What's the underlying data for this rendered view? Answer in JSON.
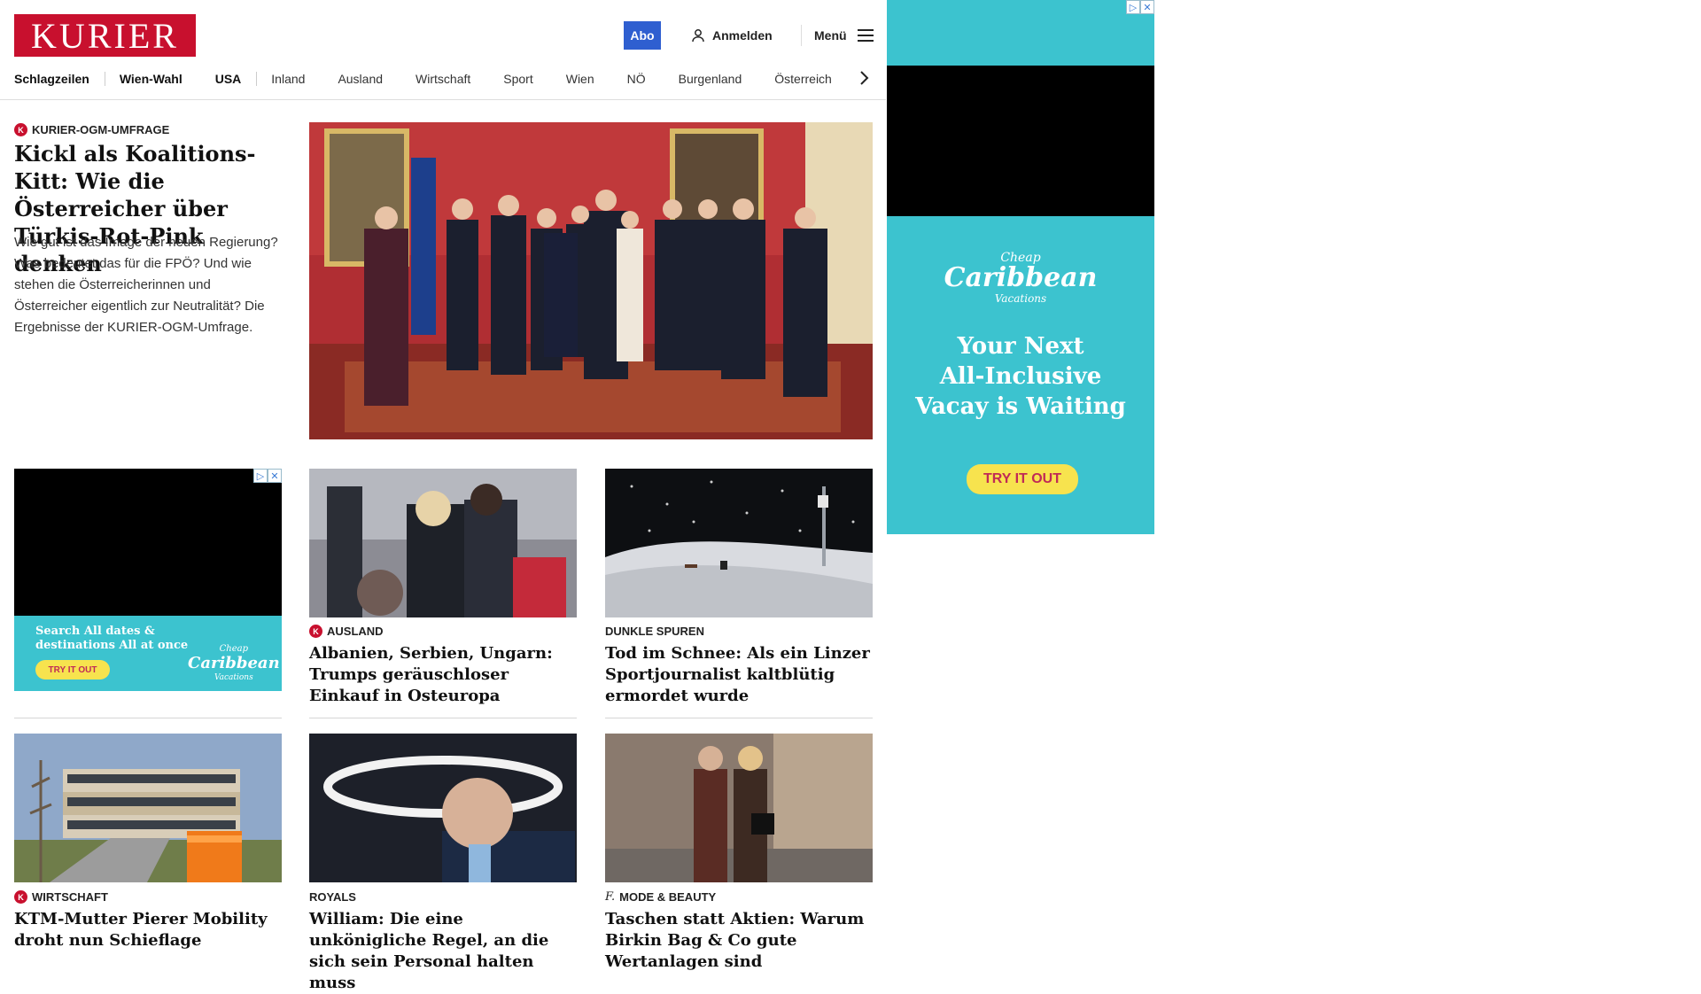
{
  "header": {
    "logo": "KURIER",
    "abo_label": "Abo",
    "login_label": "Anmelden",
    "menu_label": "Menü"
  },
  "nav": [
    "Schlagzeilen",
    "Wien-Wahl",
    "USA",
    "Inland",
    "Ausland",
    "Wirtschaft",
    "Sport",
    "Wien",
    "NÖ",
    "Burgenland",
    "Österreich"
  ],
  "lead": {
    "badge": "K",
    "kicker": "KURIER-OGM-UMFRAGE",
    "title": "Kickl als Koalitions-Kitt: Wie die Österreicher über Türkis-Rot-Pink denken",
    "teaser": "Wie gut ist das Image der neuen Regierung? Was bedeutet das für die FPÖ? Und wie stehen die Österreicherinnen und Österreicher eigentlich zur Neutralität? Die Ergebnisse der KURIER-OGM-Umfrage."
  },
  "ad_small": {
    "line1": "Search All dates &",
    "line2": "destinations All at once",
    "cta": "TRY IT OUT",
    "brand_top": "Cheap",
    "brand_main": "Caribbean",
    "brand_bottom": "Vacations"
  },
  "ad_right": {
    "brand_top": "Cheap",
    "brand_main": "Caribbean",
    "brand_bottom": "Vacations",
    "line1": "Your Next",
    "line2": "All-Inclusive",
    "line3": "Vacay is Waiting",
    "cta": "TRY IT OUT"
  },
  "cards": [
    {
      "badge": "K",
      "kicker": "AUSLAND",
      "title": "Albanien, Serbien, Ungarn: Trumps geräuschloser Einkauf in Osteuropa"
    },
    {
      "badge": "",
      "kicker": "DUNKLE SPUREN",
      "title": "Tod im Schnee: Als ein Linzer Sportjournalist kaltblütig ermordet wurde"
    },
    {
      "badge": "K",
      "kicker": "WIRTSCHAFT",
      "title": "KTM-Mutter Pierer Mobility droht nun Schieflage"
    },
    {
      "badge": "",
      "kicker": "ROYALS",
      "title": "William: Die eine unkönigliche Regel, an die sich sein Personal halten muss"
    },
    {
      "badge": "f.",
      "kicker": "MODE & BEAUTY",
      "title": "Taschen statt Aktien: Warum Birkin Bag & Co gute Wertanlagen sind"
    }
  ],
  "icons": {
    "user": "user-icon",
    "menu": "hamburger-icon",
    "chevron": "chevron-right-icon",
    "adchoices": "adchoices-icon",
    "close": "close-icon"
  },
  "colors": {
    "brand_red": "#c8102e",
    "abo_blue": "#2f5fd0",
    "ad_teal": "#3cc3cf",
    "ad_yellow": "#f7e34e"
  }
}
